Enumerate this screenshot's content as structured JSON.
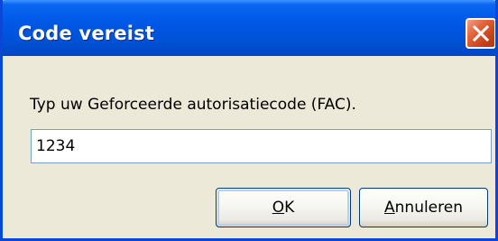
{
  "dialog": {
    "title": "Code vereist",
    "message": "Typ uw Geforceerde autorisatiecode (FAC).",
    "input_value": "1234",
    "ok_mnemonic": "O",
    "ok_rest": "K",
    "cancel_mnemonic": "A",
    "cancel_rest": "nnuleren",
    "close_icon": "close-icon"
  },
  "colors": {
    "titlebar": "#0058e6",
    "close_button": "#e2663f",
    "window_bg": "#ece9d8",
    "button_border": "#003c74"
  }
}
